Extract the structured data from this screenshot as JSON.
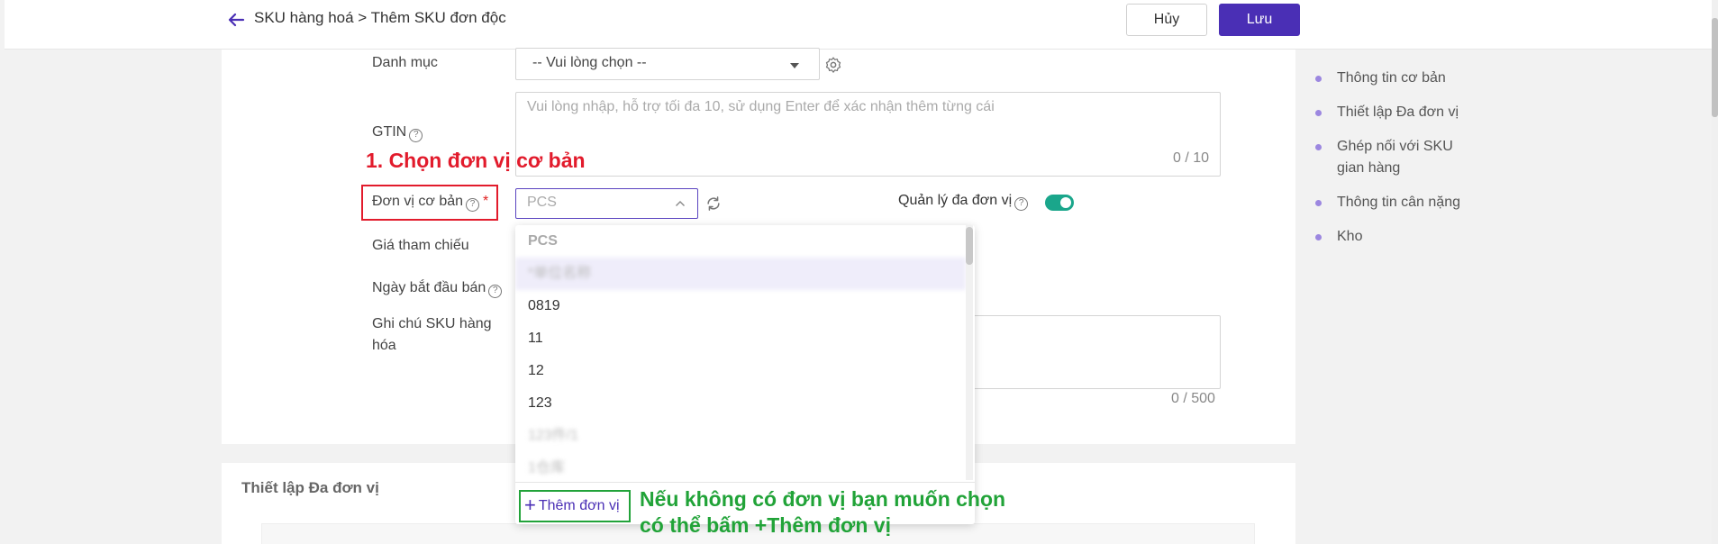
{
  "header": {
    "breadcrumb": "SKU hàng hoá > Thêm SKU đơn độc",
    "cancel_label": "Hủy",
    "save_label": "Lưu"
  },
  "form": {
    "category": {
      "label": "Danh mục",
      "value": "-- Vui lòng chọn --"
    },
    "gtin": {
      "label": "GTIN",
      "placeholder": "Vui lòng nhập, hỗ trợ tối đa 10, sử dụng Enter để xác nhận thêm từng cái",
      "count": "0 / 10"
    },
    "base_unit": {
      "label": "Đơn vị cơ bản",
      "required_mark": "*",
      "placeholder": "PCS"
    },
    "multi_unit": {
      "label": "Quản lý đa đơn vị",
      "enabled": true
    },
    "reference_price": {
      "label": "Giá tham chiếu"
    },
    "sale_start_date": {
      "label": "Ngày bắt đầu bán"
    },
    "note": {
      "label": "Ghi chú SKU hàng hóa",
      "count": "0 / 500"
    }
  },
  "dropdown": {
    "options": [
      "PCS",
      "*单位名称",
      "0819",
      "11",
      "12",
      "123",
      "123件/1",
      "1仓库"
    ],
    "add_unit_label": "Thêm đơn vị"
  },
  "annotations": {
    "step1": "1. Chọn đơn vị cơ bản",
    "hint_line1": "Nếu không có đơn vị bạn muốn chọn",
    "hint_line2": "có thể bấm +Thêm đơn vị"
  },
  "section2": {
    "title": "Thiết lập Đa đơn vị"
  },
  "anchor_nav": [
    "Thông tin cơ bản",
    "Thiết lập Đa đơn vị",
    "Ghép nối với SKU gian hàng",
    "Thông tin cân nặng",
    "Kho"
  ],
  "colors": {
    "primary": "#4a2fb5",
    "toggle_on": "#1aa68b",
    "annotation_red": "#e21b2c",
    "annotation_green": "#21a338"
  }
}
